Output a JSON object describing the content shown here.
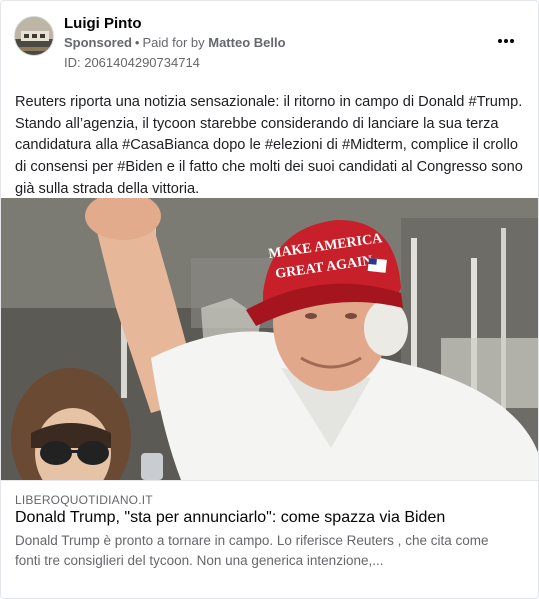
{
  "post": {
    "author": "Luigi Pinto",
    "sponsored_label": "Sponsored",
    "separator": "•",
    "paid_for_prefix": "Paid for by",
    "payer": "Matteo Bello",
    "id_label": "ID: 2061404290734714",
    "more_icon": "more-horizontal-icon",
    "text": "Reuters riporta una notizia sensazionale: il ritorno in campo di Donald #Trump. Stando all’agenzia, il tycoon starebbe considerando di lanciare la sua terza candidatura alla #CasaBianca dopo le #elezioni di #Midterm, complice il crollo di consensi per #Biden e il fatto che molti dei suoi candidati al Congresso sono già sulla strada della vittoria."
  },
  "photo": {
    "hat_line1": "MAKE AMERICA",
    "hat_line2": "GREAT AGAIN",
    "hat_color": "#c8202a"
  },
  "link": {
    "domain": "LIBEROQUOTIDIANO.IT",
    "title": "Donald Trump, \"sta per annunciarlo\": come spazza via Biden",
    "description": "Donald Trump è pronto a tornare in campo. Lo riferisce Reuters , che cita come fonti tre consiglieri del tycoon. Non una generica intenzione,..."
  },
  "colors": {
    "text_primary": "#050505",
    "text_secondary": "#65676b",
    "border": "#e4e6eb"
  }
}
